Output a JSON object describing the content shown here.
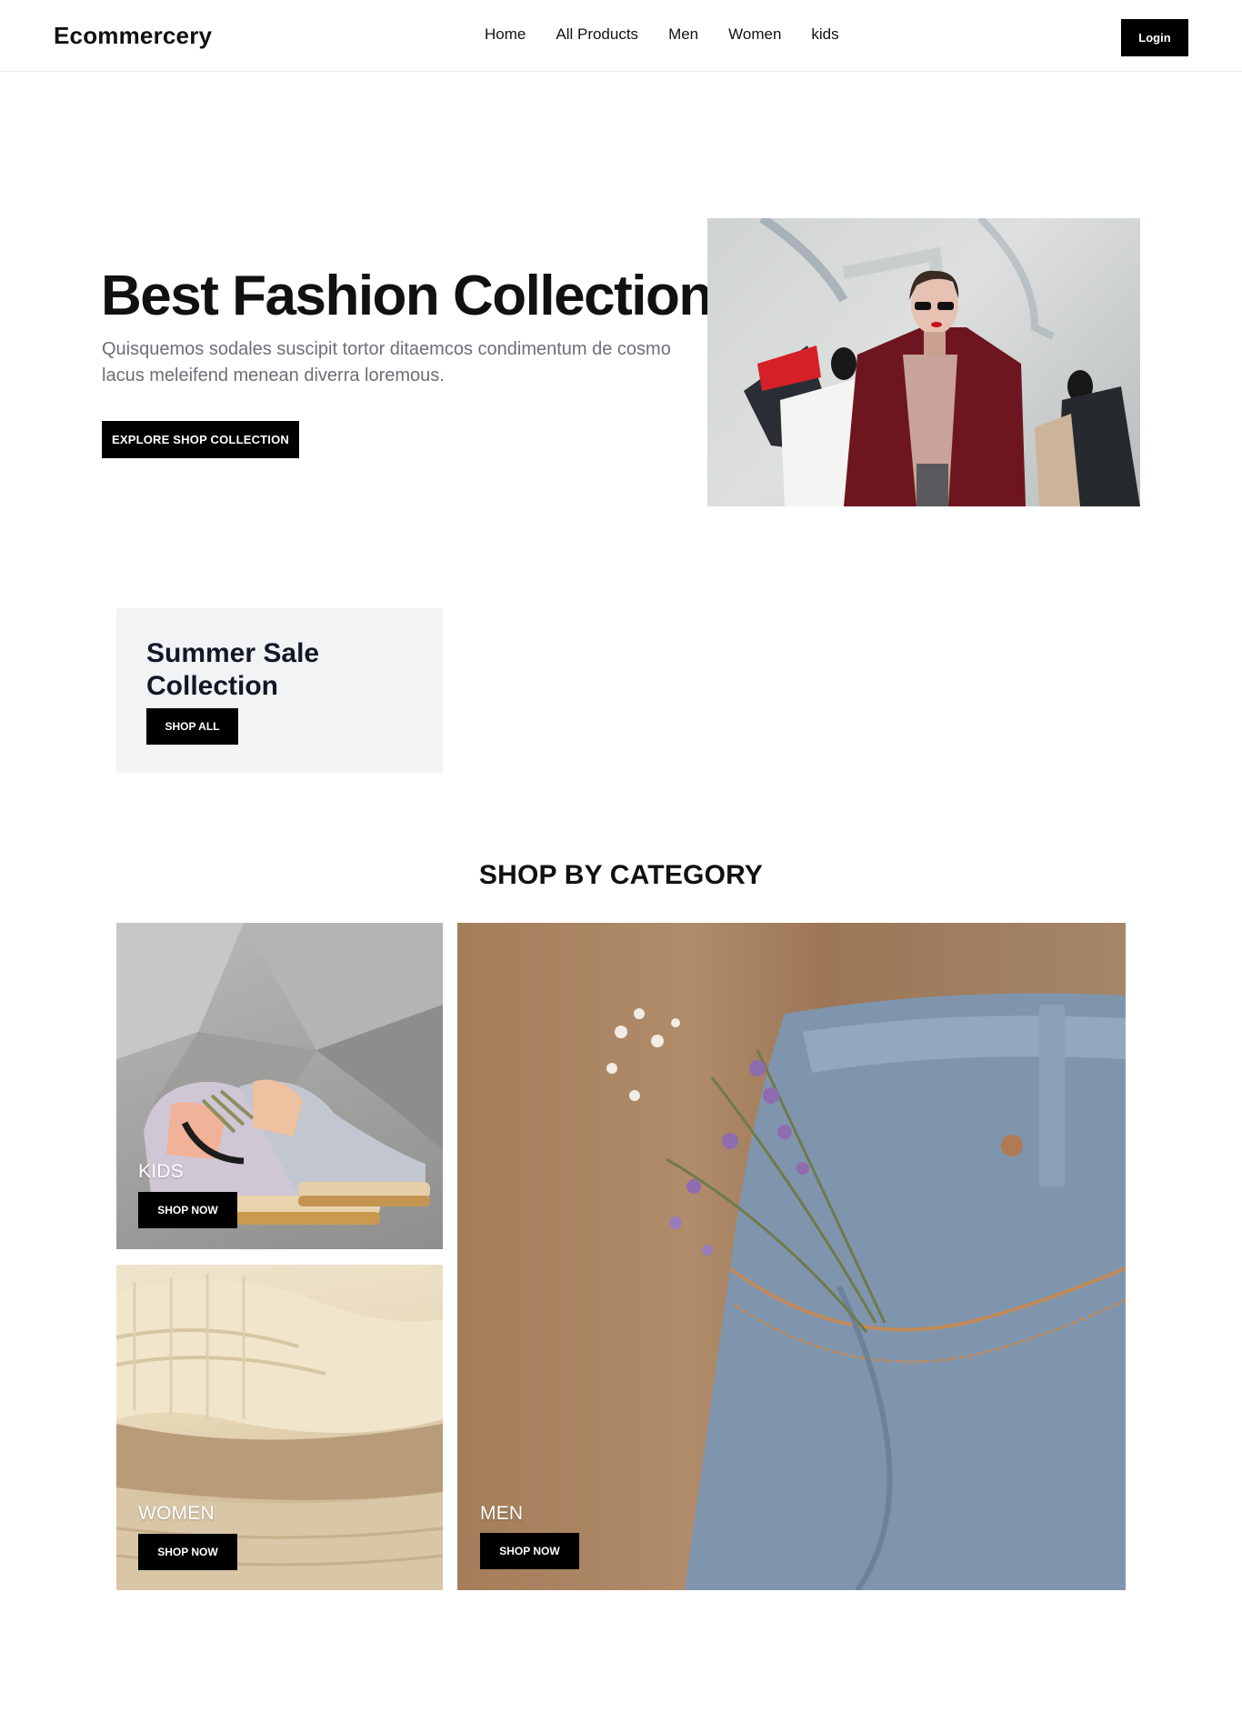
{
  "header": {
    "brand": "Ecommercery",
    "nav": [
      "Home",
      "All Products",
      "Men",
      "Women",
      "kids"
    ],
    "login_label": "Login"
  },
  "hero": {
    "title": "Best Fashion Collection",
    "subtitle": "Quisquemos sodales suscipit tortor ditaemcos condimentum de cosmo lacus meleifend menean diverra loremous.",
    "cta_label": "EXPLORE SHOP COLLECTION",
    "image": "woman-with-shopping-bags-photo"
  },
  "promo": {
    "title": "Summer Sale Collection",
    "cta_label": "SHOP ALL"
  },
  "categories": {
    "heading": "SHOP BY CATEGORY",
    "items": [
      {
        "label": "KIDS",
        "cta_label": "SHOP NOW",
        "image": "sneakers-photo"
      },
      {
        "label": "WOMEN",
        "cta_label": "SHOP NOW",
        "image": "knit-sweaters-photo"
      },
      {
        "label": "MEN",
        "cta_label": "SHOP NOW",
        "image": "jeans-with-flowers-photo"
      }
    ]
  },
  "colors": {
    "button_bg": "#000000",
    "promo_bg": "#f2f3f5",
    "subtitle_text": "#6b6f76"
  }
}
